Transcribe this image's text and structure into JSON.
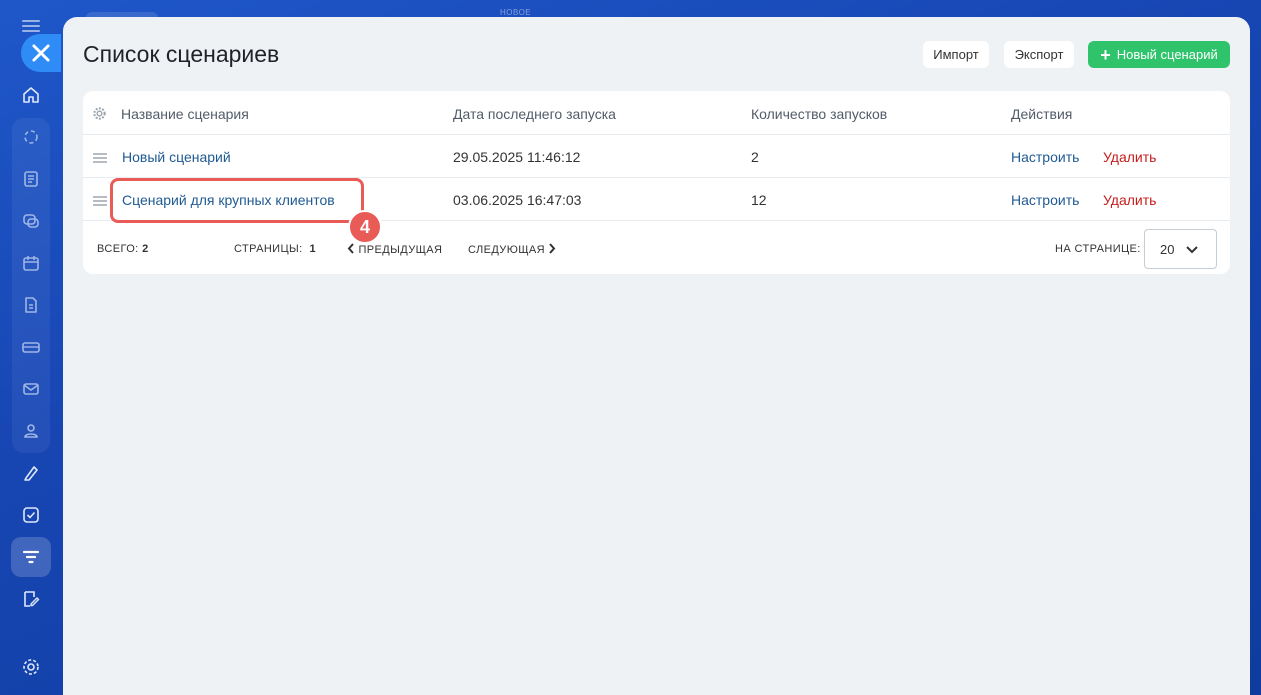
{
  "topbar": {
    "label": "НОВОЕ"
  },
  "sidebar": {
    "icons": [
      "menu-icon",
      "close-icon",
      "home-icon",
      "crm-icon",
      "tasks-icon",
      "chat-icon",
      "calendar-icon",
      "document-icon",
      "payment-icon",
      "mail-icon",
      "contacts-icon",
      "sign-icon",
      "checkbox-icon",
      "filter-icon",
      "edit-icon",
      "settings-icon"
    ],
    "active": "filter-icon"
  },
  "page": {
    "title": "Список сценариев",
    "import_label": "Импорт",
    "export_label": "Экспорт",
    "new_label": "Новый сценарий"
  },
  "table": {
    "headers": {
      "name": "Название сценария",
      "last_run": "Дата последнего запуска",
      "count": "Количество запусков",
      "actions": "Действия"
    },
    "rows": [
      {
        "name": "Новый сценарий",
        "last_run": "29.05.2025 11:46:12",
        "count": "2",
        "configure": "Настроить",
        "delete": "Удалить"
      },
      {
        "name": "Сценарий для крупных клиентов",
        "last_run": "03.06.2025 16:47:03",
        "count": "12",
        "configure": "Настроить",
        "delete": "Удалить"
      }
    ]
  },
  "footer": {
    "total_label": "ВСЕГО:",
    "total_value": "2",
    "pages_label": "СТРАНИЦЫ:",
    "pages_value": "1",
    "prev_label": "ПРЕДЫДУЩАЯ",
    "next_label": "СЛЕДУЮЩАЯ",
    "per_page_label": "НА СТРАНИЦЕ:",
    "per_page_value": "20"
  },
  "annotation": {
    "step": "4"
  },
  "colors": {
    "accent_green": "#2fc46c",
    "link": "#1f5a92",
    "danger": "#c91c1c",
    "highlight": "#e85b56"
  }
}
